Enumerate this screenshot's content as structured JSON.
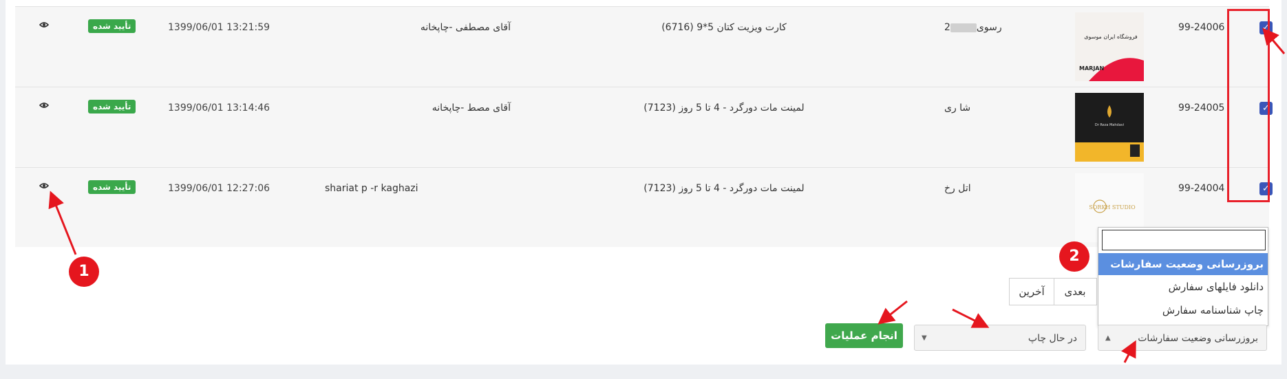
{
  "rows": [
    {
      "checked": true,
      "code": "99-24006",
      "customer": "رسوی",
      "customer_prefix": "2",
      "product": "(6716) کارت ویزیت کتان 5*9",
      "agent": "آقای مصطفی   -چاپخانه",
      "date": "1399/06/01 13:21:59",
      "status": "تأیید شده",
      "thumb": {
        "caption": "فروشگاه ایران موسوی",
        "brand": "MARJAN",
        "bg": "#e8173d"
      }
    },
    {
      "checked": true,
      "code": "99-24005",
      "customer": "شا    ری",
      "product": "(7123) لمینت مات دورگرد - 4 تا 5 روز",
      "agent": "آقای مصط   -چاپخانه",
      "date": "1399/06/01 13:14:46",
      "status": "تأیید شده",
      "thumb": {
        "caption": "Dr Reza Mahdavi",
        "bg": "#1a1a1a"
      }
    },
    {
      "checked": true,
      "code": "99-24004",
      "customer": "اتل    رخ",
      "product": "(7123) لمینت مات دورگرد - 4 تا 5 روز",
      "agent": "shariat p    -r       kaghazi",
      "date": "1399/06/01 12:27:06",
      "status": "تأیید شده",
      "thumb": {
        "caption": "SORKH STUDIO",
        "bg": "#ffffff"
      }
    }
  ],
  "checkbox_mark": "✓",
  "eye_icon_glyph": "👁",
  "markers": {
    "m1": "1",
    "m2": "2"
  },
  "pagination": {
    "next": "بعدی",
    "last": "آخرین"
  },
  "dropdown": {
    "search_value": "",
    "options": [
      "بروزرسانی وضعیت سفارشات",
      "دانلود فایلهای سفارش",
      "چاپ شناسنامه سفارش"
    ],
    "active_index": 0
  },
  "action_select": {
    "value": "بروزرسانی وضعیت سفارشات"
  },
  "status_select": {
    "value": "در حال چاپ"
  },
  "execute_button": "انجام عملیات",
  "colors": {
    "accent_green": "#40a84d",
    "checkbox_blue": "#3a56b8",
    "annotation_red": "#e5161e"
  }
}
